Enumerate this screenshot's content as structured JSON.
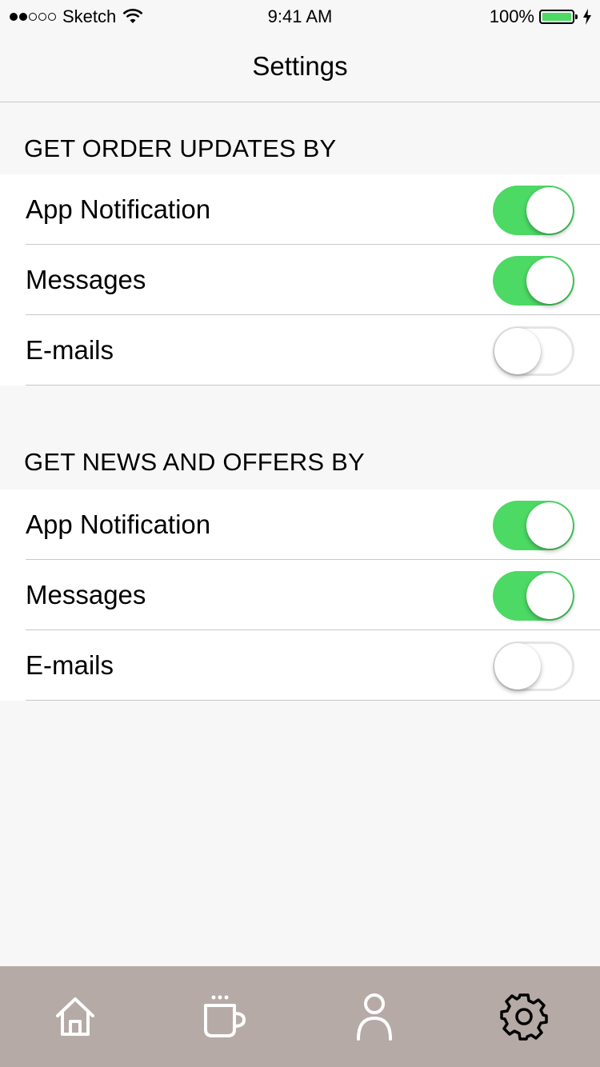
{
  "status_bar": {
    "carrier": "Sketch",
    "time": "9:41 AM",
    "battery": "100%",
    "battery_color": "#4cd964"
  },
  "nav": {
    "title": "Settings"
  },
  "sections": [
    {
      "header": "GET ORDER UPDATES BY",
      "rows": [
        {
          "label": "App Notification",
          "enabled": true
        },
        {
          "label": "Messages",
          "enabled": true
        },
        {
          "label": "E-mails",
          "enabled": false
        }
      ]
    },
    {
      "header": "GET NEWS AND OFFERS BY",
      "rows": [
        {
          "label": "App Notification",
          "enabled": true
        },
        {
          "label": "Messages",
          "enabled": true
        },
        {
          "label": "E-mails",
          "enabled": false
        }
      ]
    }
  ],
  "tab_bar": {
    "background": "#b5aaa5",
    "tabs": [
      {
        "icon": "home-icon"
      },
      {
        "icon": "coffee-cup-icon"
      },
      {
        "icon": "user-icon"
      },
      {
        "icon": "gear-icon",
        "selected": true
      }
    ]
  },
  "colors": {
    "toggle_on": "#4cd964",
    "background": "#f7f7f7"
  }
}
